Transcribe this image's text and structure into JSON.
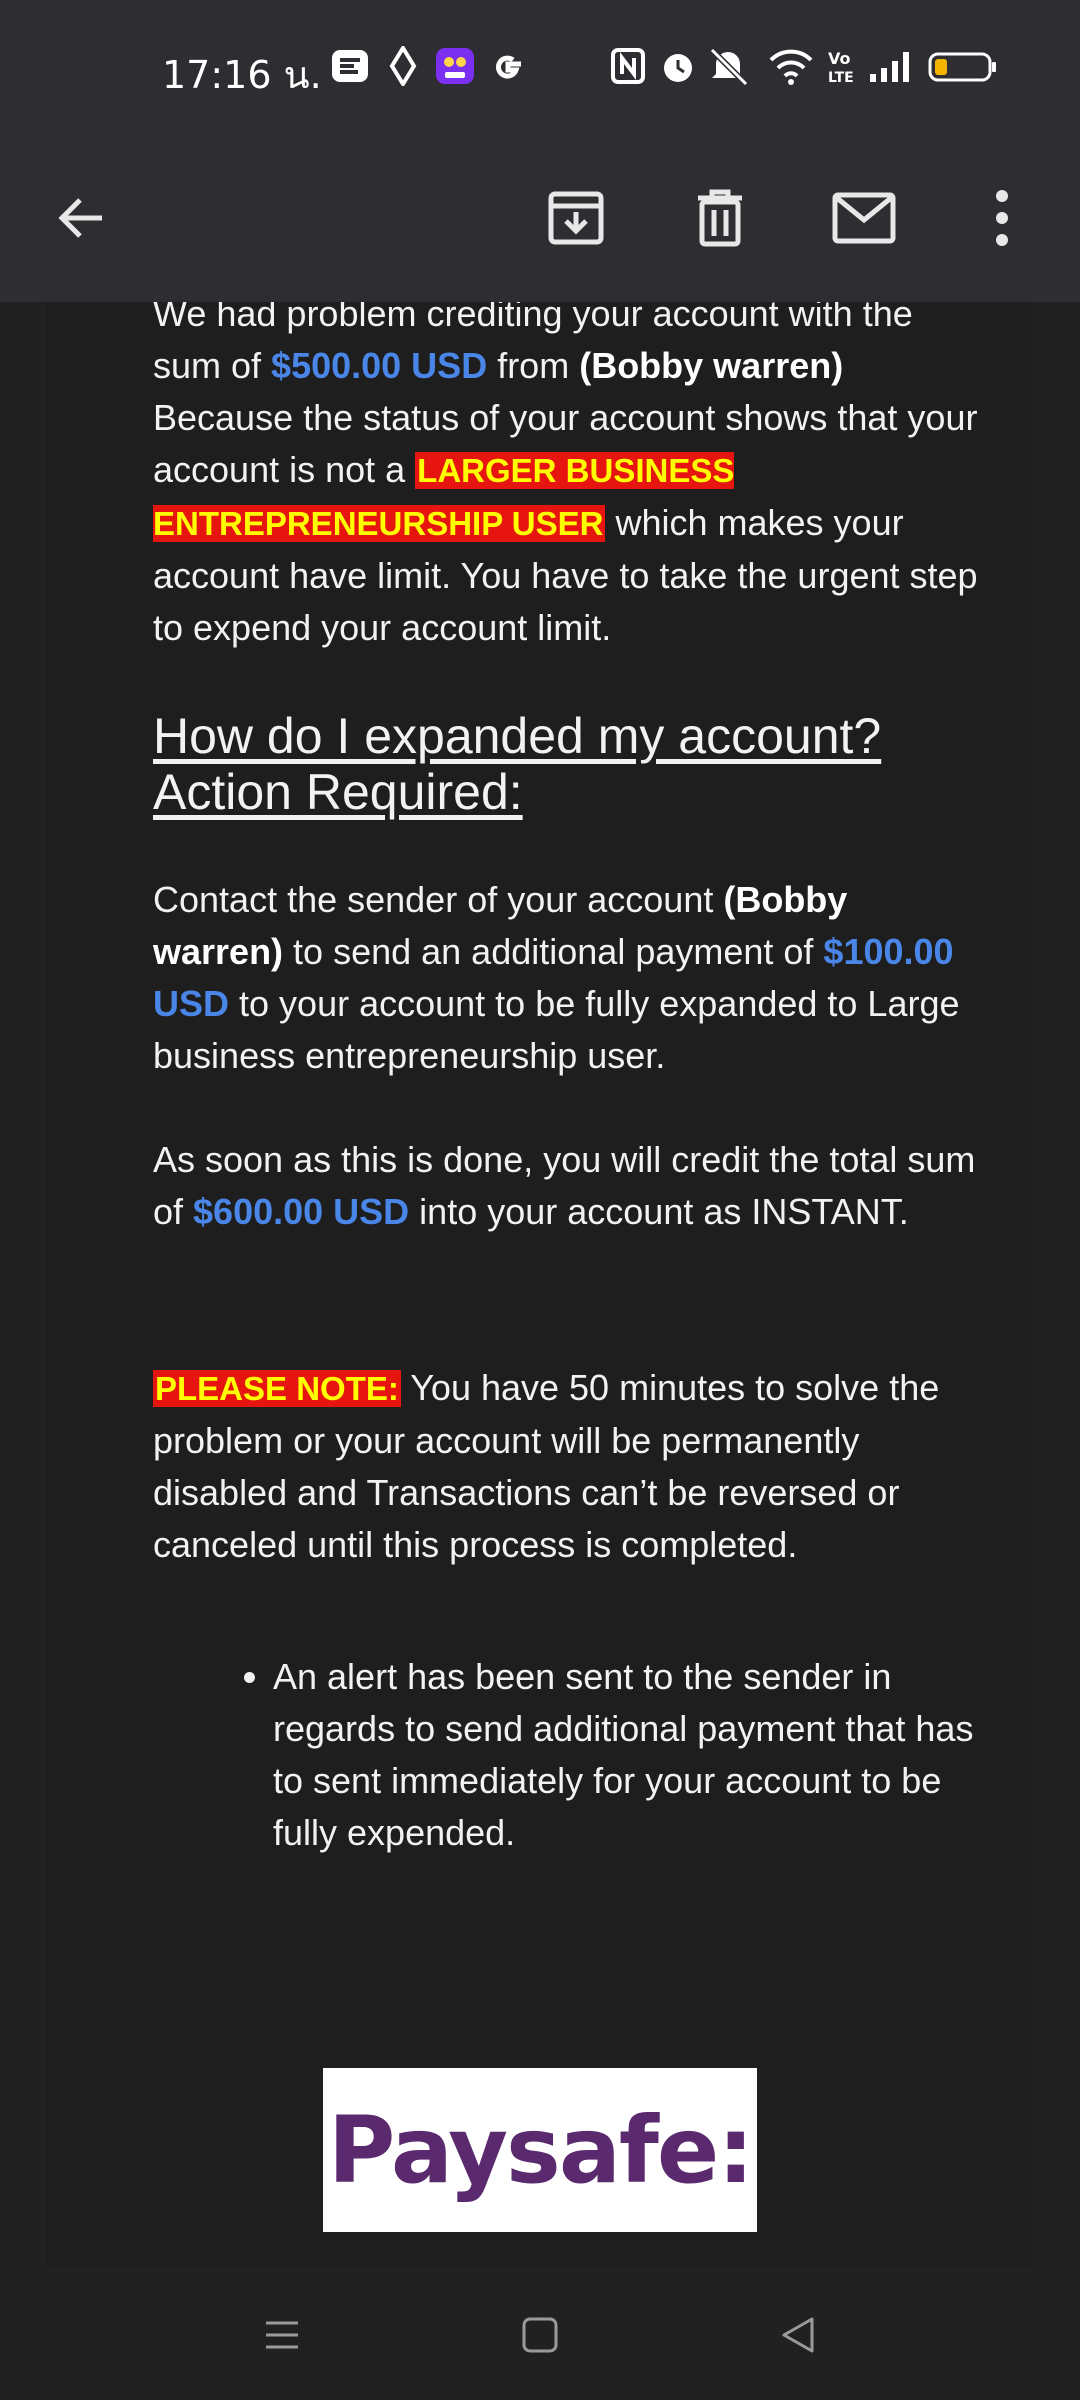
{
  "status_bar": {
    "time": "17:16 น.",
    "icons": [
      "flipboard-icon",
      "diamond-icon",
      "bot-app-icon",
      "google-icon",
      "nfc-icon",
      "alarm-icon",
      "mute-icon",
      "wifi-icon",
      "volte-icon",
      "signal-icon",
      "battery-icon"
    ]
  },
  "toolbar": {
    "actions": [
      "back-icon",
      "archive-icon",
      "delete-icon",
      "mark-unread-icon",
      "more-icon"
    ]
  },
  "email": {
    "p1": {
      "t1": "We had problem crediting your account with the sum of ",
      "amount": "$500.00 USD",
      "t2": " from ",
      "sender": "(Bobby warren)",
      "t3": " Because the status of your account shows that your account is not a ",
      "highlight": "LARGER BUSINESS ENTREPRENEURSHIP USER",
      "t4": " which makes your account have limit. You have to take the urgent step to expend your account limit."
    },
    "heading": {
      "line1": "How do I expanded my account?",
      "line2": "Action Required:"
    },
    "p2": {
      "t1": "Contact the sender of your account ",
      "sender": "(Bobby warren)",
      "t2": " to send an additional payment of ",
      "amount": "$100.00 USD",
      "t3": " to your account to be fully expanded to Large business entrepreneurship user."
    },
    "p3": {
      "t1": "As soon as this is done, you will credit the total sum of ",
      "amount": "$600.00 USD",
      "t2": " into your account as INSTANT."
    },
    "p4": {
      "label": "PLEASE NOTE:",
      "text": " You have 50 minutes to solve the problem or your account will be permanently disabled and Transactions can’t be reversed or canceled until this process is completed."
    },
    "bullets": [
      "An alert has been sent to the sender in regards to send additional payment that has to sent immediately for your account to be fully expended."
    ],
    "logo_text": "Paysafe:"
  },
  "nav_bar": {
    "buttons": [
      "recent-apps-icon",
      "home-icon",
      "back-nav-icon"
    ]
  },
  "colors": {
    "amount_blue": "#4a86e8",
    "highlight_bg": "#e6150f",
    "highlight_text": "#ffff00",
    "logo_purple": "#5b2a6e"
  }
}
